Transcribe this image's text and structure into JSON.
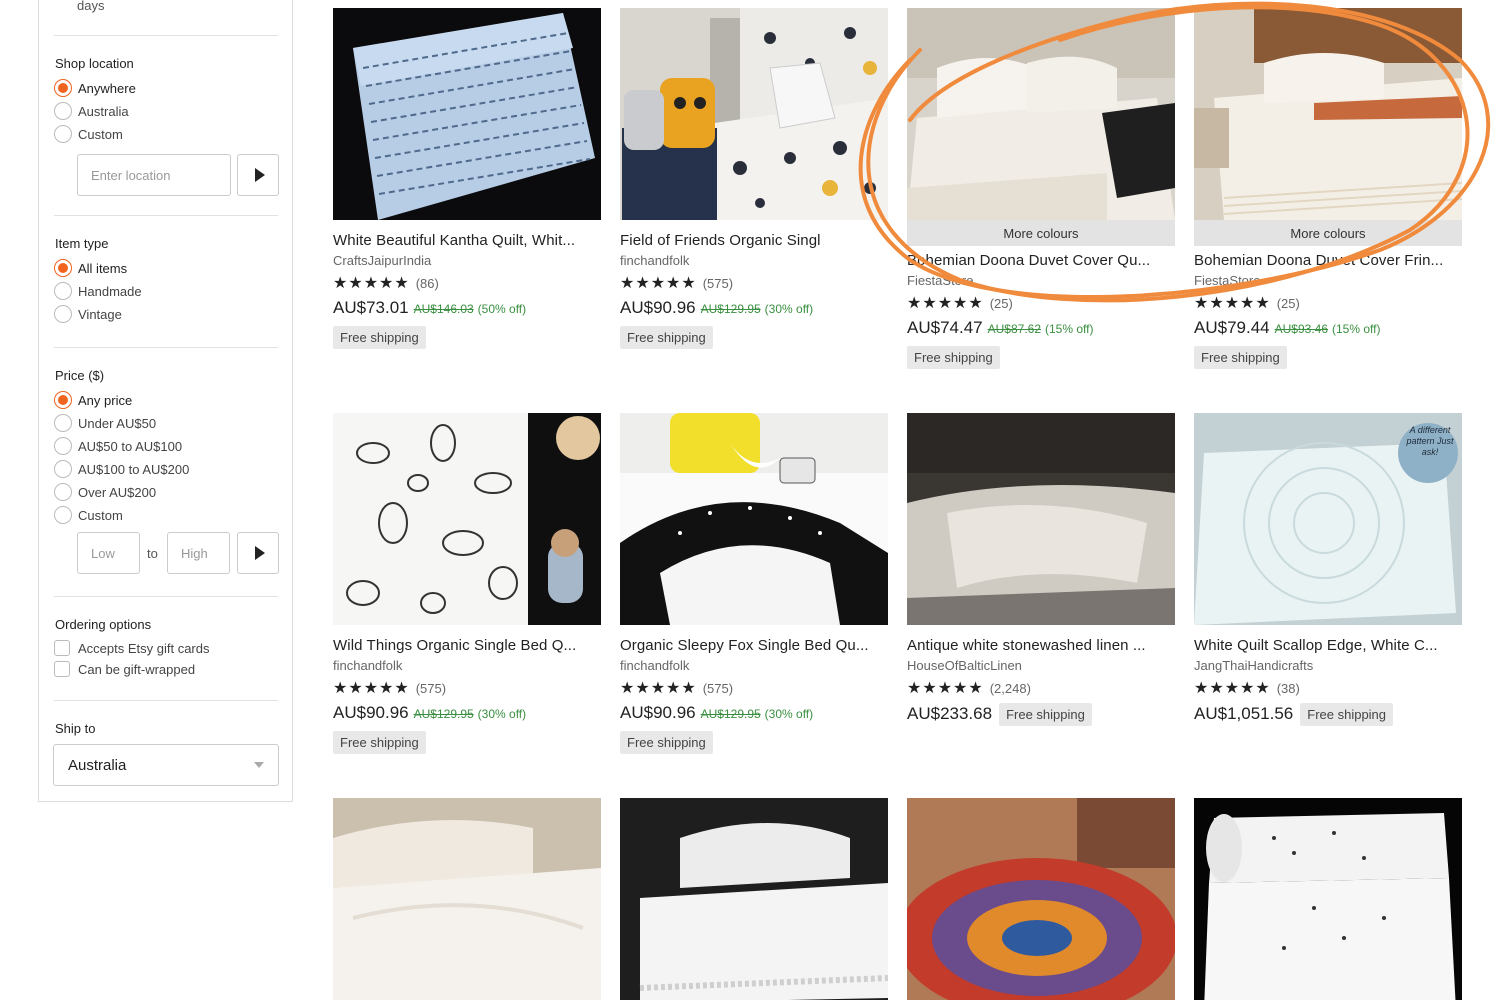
{
  "sidebar": {
    "days_text": "days",
    "shop_location": {
      "heading": "Shop location",
      "options": [
        "Anywhere",
        "Australia",
        "Custom"
      ],
      "selected": "Anywhere",
      "placeholder": "Enter location"
    },
    "item_type": {
      "heading": "Item type",
      "options": [
        "All items",
        "Handmade",
        "Vintage"
      ],
      "selected": "All items"
    },
    "price": {
      "heading": "Price ($)",
      "options": [
        "Any price",
        "Under AU$50",
        "AU$50 to AU$100",
        "AU$100 to AU$200",
        "Over AU$200",
        "Custom"
      ],
      "selected": "Any price",
      "low_placeholder": "Low",
      "high_placeholder": "High",
      "to_label": "to"
    },
    "ordering": {
      "heading": "Ordering options",
      "options": [
        "Accepts Etsy gift cards",
        "Can be gift-wrapped"
      ]
    },
    "ship_to": {
      "heading": "Ship to",
      "value": "Australia"
    }
  },
  "products": [
    {
      "title": "White Beautiful Kantha Quilt, Whit...",
      "shop": "CraftsJaipurIndia",
      "stars": "★★★★★",
      "reviews": "(86)",
      "price": "AU$73.01",
      "original": "AU$146.03",
      "discount": "(50% off)",
      "shipping": "Free shipping",
      "more_colours": ""
    },
    {
      "title": "Field of Friends Organic Singl",
      "shop": "finchandfolk",
      "stars": "★★★★★",
      "reviews": "(575)",
      "price": "AU$90.96",
      "original": "AU$129.95",
      "discount": "(30% off)",
      "shipping": "Free shipping",
      "more_colours": ""
    },
    {
      "title": "Bohemian Doona Duvet Cover Qu...",
      "shop": "FiestaStore",
      "stars": "★★★★★",
      "reviews": "(25)",
      "price": "AU$74.47",
      "original": "AU$87.62",
      "discount": "(15% off)",
      "shipping": "Free shipping",
      "more_colours": "More colours"
    },
    {
      "title": "Bohemian Doona Duvet Cover Frin...",
      "shop": "FiestaStore",
      "stars": "★★★★★",
      "reviews": "(25)",
      "price": "AU$79.44",
      "original": "AU$93.46",
      "discount": "(15% off)",
      "shipping": "Free shipping",
      "more_colours": "More colours"
    },
    {
      "title": "Wild Things Organic Single Bed Q...",
      "shop": "finchandfolk",
      "stars": "★★★★★",
      "reviews": "(575)",
      "price": "AU$90.96",
      "original": "AU$129.95",
      "discount": "(30% off)",
      "shipping": "Free shipping",
      "more_colours": ""
    },
    {
      "title": "Organic Sleepy Fox Single Bed Qu...",
      "shop": "finchandfolk",
      "stars": "★★★★★",
      "reviews": "(575)",
      "price": "AU$90.96",
      "original": "AU$129.95",
      "discount": "(30% off)",
      "shipping": "Free shipping",
      "more_colours": ""
    },
    {
      "title": "Antique white stonewashed linen ...",
      "shop": "HouseOfBalticLinen",
      "stars": "★★★★★",
      "reviews": "(2,248)",
      "price": "AU$233.68",
      "original": "",
      "discount": "",
      "shipping": "Free shipping",
      "more_colours": ""
    },
    {
      "title": "White Quilt Scallop Edge, White C...",
      "shop": "JangThaiHandicrafts",
      "stars": "★★★★★",
      "reviews": "(38)",
      "price": "AU$1,051.56",
      "original": "",
      "discount": "",
      "shipping": "Free shipping",
      "more_colours": "",
      "badge": "A different pattern Just ask!"
    },
    {
      "title": "",
      "shop": "",
      "stars": "",
      "reviews": "",
      "price": "",
      "original": "",
      "discount": "",
      "shipping": "",
      "more_colours": ""
    },
    {
      "title": "",
      "shop": "",
      "stars": "",
      "reviews": "",
      "price": "",
      "original": "",
      "discount": "",
      "shipping": "",
      "more_colours": ""
    },
    {
      "title": "",
      "shop": "",
      "stars": "",
      "reviews": "",
      "price": "",
      "original": "",
      "discount": "",
      "shipping": "",
      "more_colours": ""
    },
    {
      "title": "",
      "shop": "",
      "stars": "",
      "reviews": "",
      "price": "",
      "original": "",
      "discount": "",
      "shipping": "",
      "more_colours": ""
    }
  ],
  "colors": {
    "accent": "#f1641e",
    "discount_green": "#3a8f40",
    "annotation": "#f08a3c"
  },
  "icons": [
    "play-arrow-icon",
    "chevron-down-icon",
    "star-icon"
  ]
}
